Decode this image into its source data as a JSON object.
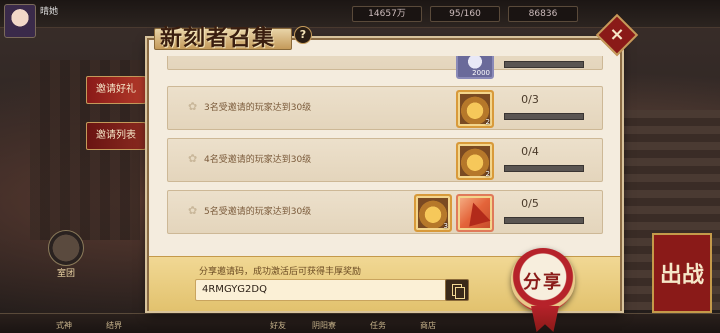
{
  "background": {
    "player_name": "晴她",
    "resources": [
      "14657万",
      "95/160",
      "86836"
    ],
    "left_badge_label": "室团",
    "banner_text": "出战",
    "bottom_items": [
      "式神",
      "结界",
      "商店",
      "好友",
      "阴阳寮",
      "任务"
    ]
  },
  "dialog": {
    "title": "新刻者召集",
    "help_label": "?",
    "close_label": "×",
    "tabs": [
      {
        "label": "邀请好礼",
        "active": true
      },
      {
        "label": "邀请列表",
        "active": false
      }
    ],
    "top_partial": {
      "item_qty": "2000"
    },
    "rows": [
      {
        "text": "3名受邀请的玩家达到30级",
        "progress_text": "0/3",
        "progress": 0,
        "rewards": [
          {
            "icon": "gold-coin-icon",
            "qty": "2"
          }
        ]
      },
      {
        "text": "4名受邀请的玩家达到30级",
        "progress_text": "0/4",
        "progress": 0,
        "rewards": [
          {
            "icon": "gold-coin-icon",
            "qty": "2"
          }
        ]
      },
      {
        "text": "5名受邀请的玩家达到30级",
        "progress_text": "0/5",
        "progress": 0,
        "rewards": [
          {
            "icon": "gold-coin-icon",
            "qty": "3"
          },
          {
            "icon": "paper-crane-icon",
            "qty": ""
          }
        ]
      }
    ],
    "share": {
      "hint": "分享邀请码，成功激活后可获得丰厚奖励",
      "code": "4RMGYG2DQ",
      "button_label": "分享"
    }
  }
}
